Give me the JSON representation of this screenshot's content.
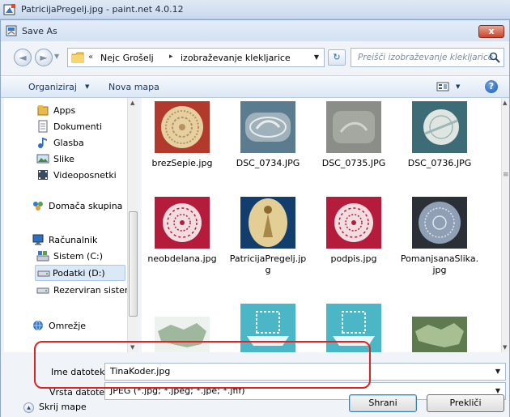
{
  "app": {
    "title": "PatricijaPregelj.jpg - paint.net 4.0.12"
  },
  "dialog": {
    "title": "Save As",
    "close_label": "x"
  },
  "address": {
    "crumbs": [
      "Nejc Grošelj",
      "izobraževanje klekljarice"
    ],
    "sep0": "«",
    "sep1": "▸"
  },
  "search": {
    "placeholder": "Preišči izobraževanje klekljarice"
  },
  "toolbar": {
    "organize_label": "Organiziraj",
    "new_folder_label": "Nova mapa"
  },
  "nav_pane": {
    "items": [
      {
        "label": "Apps",
        "icon": "apps-icon"
      },
      {
        "label": "Dokumenti",
        "icon": "documents-icon"
      },
      {
        "label": "Glasba",
        "icon": "music-icon"
      },
      {
        "label": "Slike",
        "icon": "pictures-icon"
      },
      {
        "label": "Videoposnetki",
        "icon": "videos-icon"
      },
      {
        "label": "Domača skupina",
        "icon": "homegroup-icon"
      },
      {
        "label": "Računalnik",
        "icon": "computer-icon"
      },
      {
        "label": "Sistem (C:)",
        "icon": "drive-c-icon"
      },
      {
        "label": "Podatki (D:)",
        "icon": "drive-d-icon",
        "selected": true
      },
      {
        "label": "Rezerviran sistem",
        "icon": "drive-reserved-icon"
      },
      {
        "label": "Omrežje",
        "icon": "network-icon"
      }
    ]
  },
  "files": [
    {
      "name": "brezSepie.jpg"
    },
    {
      "name": "DSC_0734.JPG"
    },
    {
      "name": "DSC_0735.JPG"
    },
    {
      "name": "DSC_0736.JPG"
    },
    {
      "name": "neobdelana.jpg"
    },
    {
      "name": "PatricijaPregelj.jp",
      "name2": "g"
    },
    {
      "name": "podpis.jpg"
    },
    {
      "name": "PomanjsanaSlika.",
      "name2": "jpg"
    },
    {
      "name": ""
    },
    {
      "name": ""
    },
    {
      "name": ""
    },
    {
      "name": ""
    }
  ],
  "form": {
    "filename_label": "Ime datoteke:",
    "filename_value": "TinaKoder.jpg",
    "filetype_label": "Vrsta datoteke:",
    "filetype_value": "JPEG (*.jpg; *.jpeg; *.jpe; *.jfif)"
  },
  "footer": {
    "hide_folders_label": "Skrij mape",
    "save_label": "Shrani",
    "cancel_label": "Prekliči"
  },
  "colors": {
    "highlight": "#e02222",
    "accent": "#1c58ae"
  }
}
